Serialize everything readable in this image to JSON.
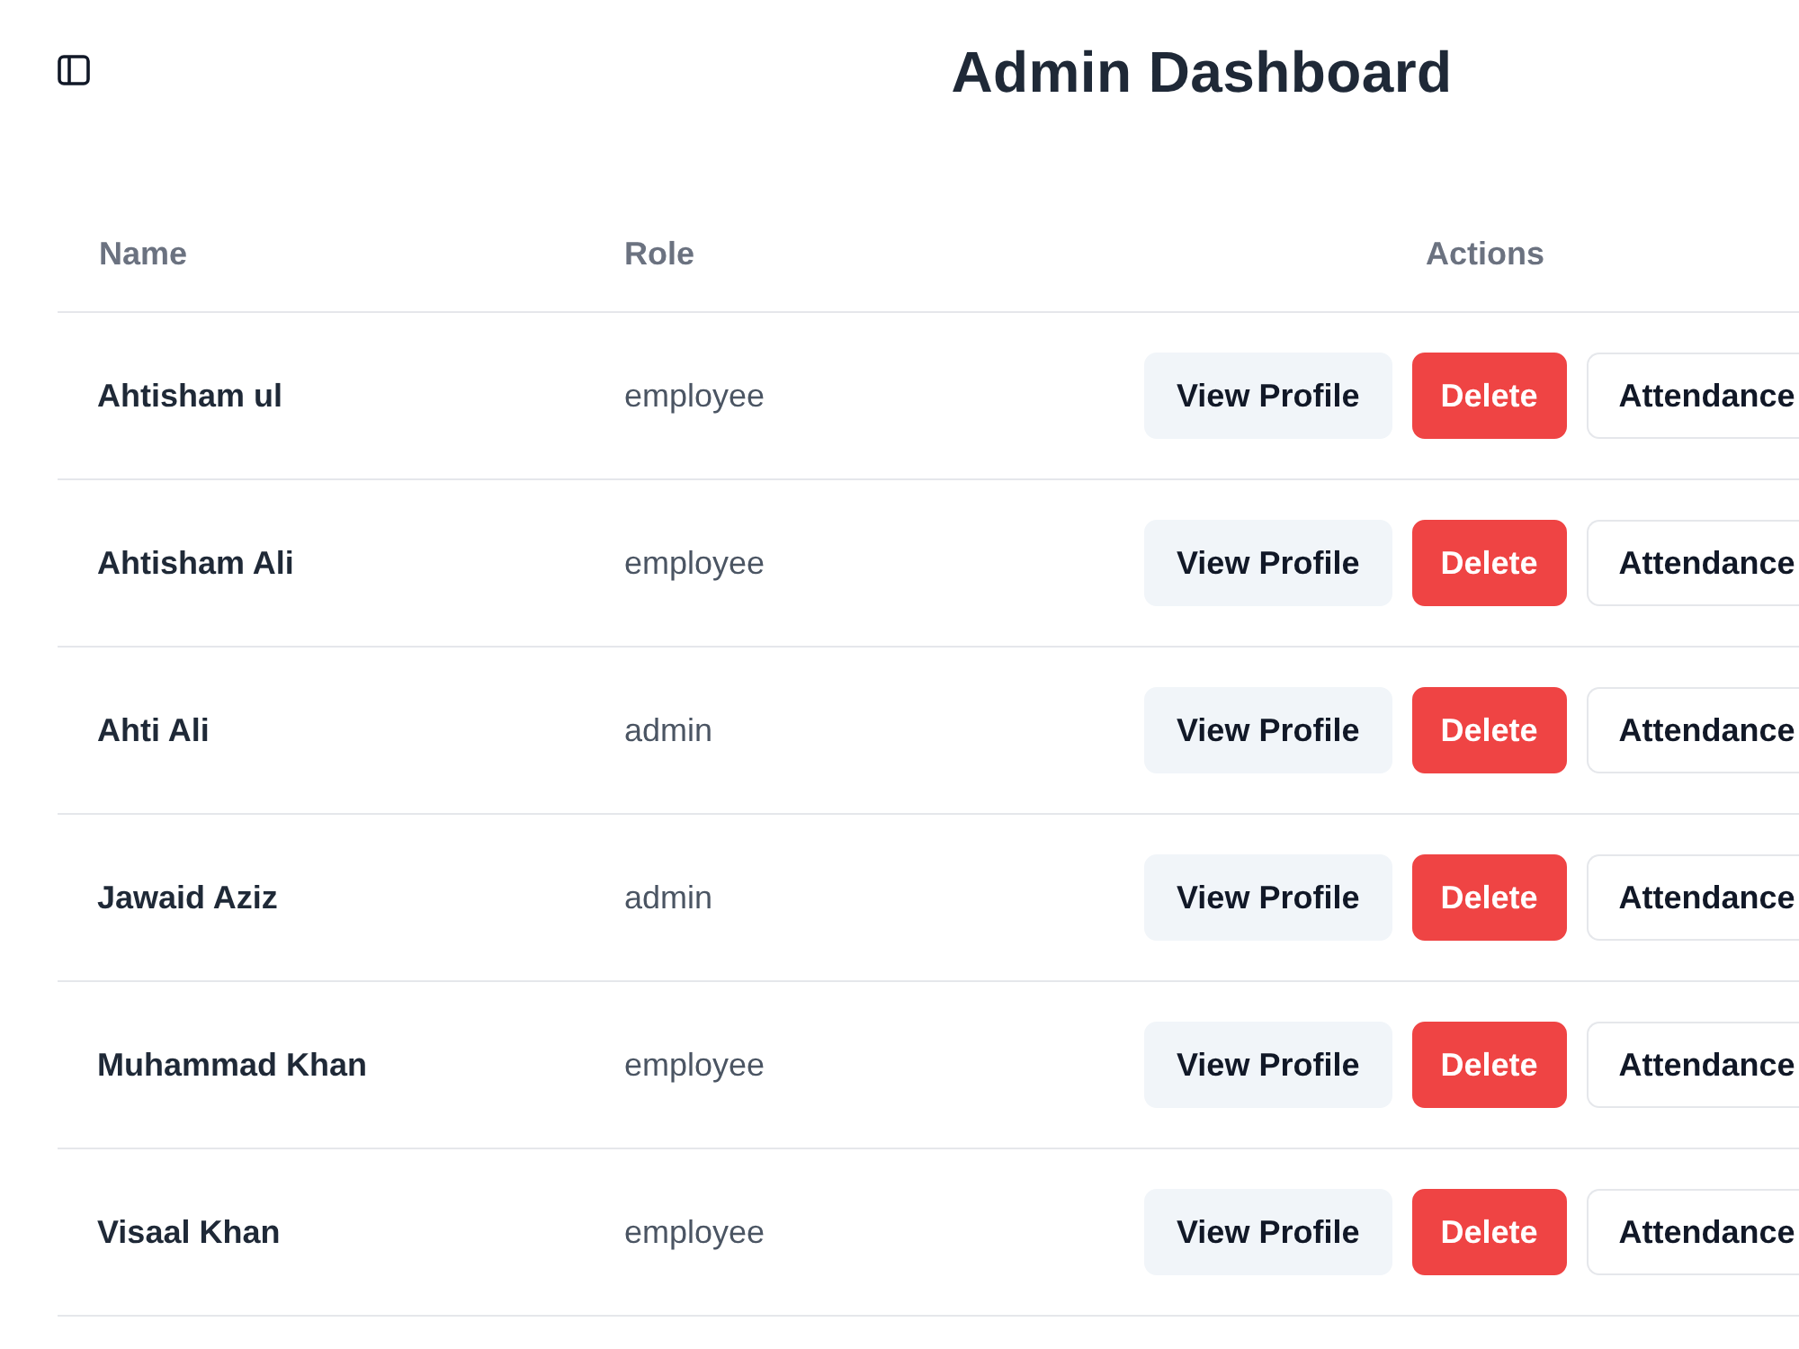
{
  "header": {
    "title": "Admin Dashboard"
  },
  "table": {
    "columns": [
      "Name",
      "Role",
      "Actions"
    ],
    "rows": [
      {
        "name": "Ahtisham ul",
        "role": "employee",
        "actions": [
          {
            "label": "View Profile",
            "kind": "secondary"
          },
          {
            "label": "Delete",
            "kind": "danger"
          },
          {
            "label": "Attendance",
            "kind": "outline"
          }
        ]
      },
      {
        "name": "Ahtisham Ali",
        "role": "employee",
        "actions": [
          {
            "label": "View Profile",
            "kind": "secondary"
          },
          {
            "label": "Delete",
            "kind": "danger"
          },
          {
            "label": "Attendance",
            "kind": "outline"
          }
        ]
      },
      {
        "name": "Ahti Ali",
        "role": "admin",
        "actions": [
          {
            "label": "View Profile",
            "kind": "secondary"
          },
          {
            "label": "Delete",
            "kind": "danger"
          },
          {
            "label": "Attendance",
            "kind": "outline"
          }
        ]
      },
      {
        "name": "Jawaid Aziz",
        "role": "admin",
        "actions": [
          {
            "label": "View Profile",
            "kind": "secondary"
          },
          {
            "label": "Delete",
            "kind": "danger"
          },
          {
            "label": "Attendance",
            "kind": "outline"
          }
        ]
      },
      {
        "name": "Muhammad Khan",
        "role": "employee",
        "actions": [
          {
            "label": "View Profile",
            "kind": "secondary"
          },
          {
            "label": "Delete",
            "kind": "danger"
          },
          {
            "label": "Attendance",
            "kind": "outline"
          }
        ]
      },
      {
        "name": "Visaal Khan",
        "role": "employee",
        "actions": [
          {
            "label": "View Profile",
            "kind": "secondary"
          },
          {
            "label": "Delete",
            "kind": "danger"
          },
          {
            "label": "Attendance",
            "kind": "outline"
          }
        ]
      }
    ]
  }
}
